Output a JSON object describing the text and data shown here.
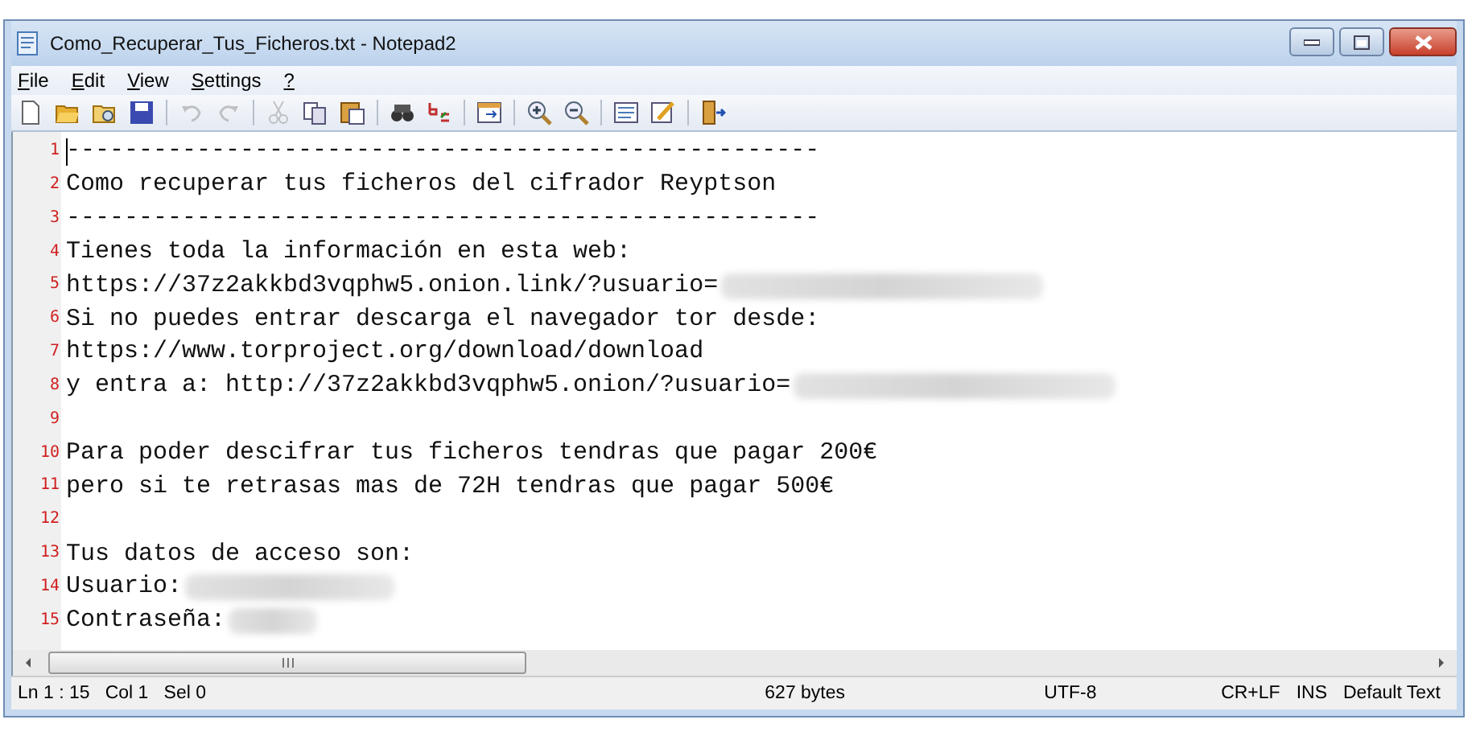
{
  "window": {
    "title": "Como_Recuperar_Tus_Ficheros.txt - Notepad2"
  },
  "menu": [
    {
      "label": "File"
    },
    {
      "label": "Edit"
    },
    {
      "label": "View"
    },
    {
      "label": "Settings"
    },
    {
      "label": "?"
    }
  ],
  "toolbar": [
    {
      "kind": "button",
      "disabled": false
    },
    {
      "kind": "button",
      "disabled": false
    },
    {
      "kind": "button",
      "disabled": false
    },
    {
      "kind": "button",
      "disabled": false
    },
    {
      "kind": "separator"
    },
    {
      "kind": "button",
      "disabled": true
    },
    {
      "kind": "button",
      "disabled": true
    },
    {
      "kind": "separator"
    },
    {
      "kind": "button",
      "disabled": true
    },
    {
      "kind": "button",
      "disabled": false
    },
    {
      "kind": "button",
      "disabled": false
    },
    {
      "kind": "separator"
    },
    {
      "kind": "button",
      "disabled": false
    },
    {
      "kind": "button",
      "disabled": false
    },
    {
      "kind": "separator"
    },
    {
      "kind": "button",
      "disabled": false
    },
    {
      "kind": "separator"
    },
    {
      "kind": "button",
      "disabled": false
    },
    {
      "kind": "button",
      "disabled": false
    },
    {
      "kind": "separator"
    },
    {
      "kind": "button",
      "disabled": false
    },
    {
      "kind": "button",
      "disabled": false
    },
    {
      "kind": "separator"
    },
    {
      "kind": "button",
      "disabled": false
    }
  ],
  "lines": [
    {
      "number": "1",
      "text": "----------------------------------------------------",
      "redacted": false
    },
    {
      "number": "2",
      "text": "Como recuperar tus ficheros del cifrador Reyptson",
      "redacted": false
    },
    {
      "number": "3",
      "text": "----------------------------------------------------",
      "redacted": false
    },
    {
      "number": "4",
      "text": "Tienes toda la información en esta web:",
      "redacted": false
    },
    {
      "number": "5",
      "text": "https://37z2akkbd3vqphw5.onion.link/?usuario=",
      "redacted": true
    },
    {
      "number": "6",
      "text": "Si no puedes entrar descarga el navegador tor desde:",
      "redacted": false
    },
    {
      "number": "7",
      "text": "https://www.torproject.org/download/download",
      "redacted": false
    },
    {
      "number": "8",
      "text": "y entra a: http://37z2akkbd3vqphw5.onion/?usuario=",
      "redacted": true
    },
    {
      "number": "9",
      "redacted": false
    },
    {
      "number": "10",
      "text": "Para poder descifrar tus ficheros tendras que pagar 200€",
      "redacted": false
    },
    {
      "number": "11",
      "text": "pero si te retrasas mas de 72H tendras que pagar 500€",
      "redacted": false
    },
    {
      "number": "12",
      "redacted": false
    },
    {
      "number": "13",
      "text": "Tus datos de acceso son:",
      "redacted": false
    },
    {
      "number": "14",
      "text": "Usuario:",
      "redacted": true
    },
    {
      "number": "15",
      "text": "Contraseña:",
      "redacted": true
    }
  ],
  "status_bar": [
    {
      "text": "Ln 1 : 15   Col 1   Sel 0"
    },
    {
      "text": "627 bytes"
    },
    {
      "text": "UTF-8"
    },
    {
      "text": "CR+LF"
    },
    {
      "text": "INS"
    },
    {
      "text": "Default Text"
    }
  ]
}
